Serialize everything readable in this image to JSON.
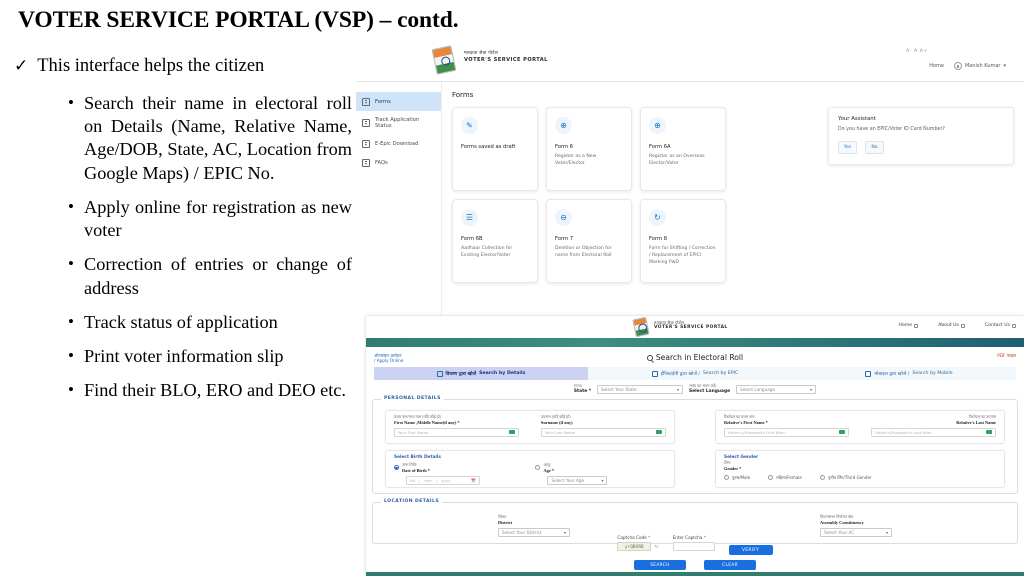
{
  "slide": {
    "title": "VOTER SERVICE PORTAL (VSP) – contd.",
    "lead_tick": "✓",
    "lead_text": "This interface helps the citizen",
    "bullet_glyph": "•",
    "bullets": [
      "Search their name in electoral roll on Details (Name, Relative Name, Age/DOB, State, AC, Location from Google Maps) / EPIC No.",
      "Apply online for registration as new voter",
      "Correction of entries or change of address",
      "Track status of application",
      "Print voter information slip",
      "Find their BLO, ERO and DEO etc."
    ]
  },
  "shot_forms": {
    "brand_hi": "मतदाता सेवा पोर्टल",
    "brand_en": "VOTER'S SERVICE PORTAL",
    "font_size_control": "A- A A+",
    "nav": {
      "home": "Home",
      "user": "Manish Kumar",
      "caret": "▾"
    },
    "sidebar": [
      {
        "label": "Forms",
        "icon": "forms-icon",
        "active": true
      },
      {
        "label": "Track Application Status",
        "icon": "track-icon",
        "active": false
      },
      {
        "label": "E-Epic Download",
        "icon": "download-icon",
        "active": false
      },
      {
        "label": "FAQs",
        "icon": "faq-icon",
        "active": false
      }
    ],
    "page_title": "Forms",
    "cards": [
      {
        "glyph": "✎",
        "title": "Forms saved as draft",
        "desc": ""
      },
      {
        "glyph": "⊕",
        "title": "Form 6",
        "desc": "Register as a New Voter/Elector"
      },
      {
        "glyph": "⊕",
        "title": "Form 6A",
        "desc": "Register as an Overseas Elector/Voter"
      },
      {
        "glyph": "☰",
        "title": "Form 6B",
        "desc": "Aadhaar Collection for Existing Elector/Voter"
      },
      {
        "glyph": "⊖",
        "title": "Form 7",
        "desc": "Deletion or Objection for name from Electoral Roll"
      },
      {
        "glyph": "↻",
        "title": "Form 8",
        "desc": "Form for Shifting / Correction / Replacement of EPIC/ Marking PwD"
      }
    ],
    "assistant": {
      "title": "Your Assistant",
      "question": "Do you have an EPIC/Voter ID Card Number?",
      "yes": "Yes",
      "no": "No"
    }
  },
  "shot_search": {
    "brand_hi": "मतदाता सेवा पोर्टल",
    "brand_en": "VOTER'S SERVICE PORTAL",
    "nav": [
      {
        "label": "Home"
      },
      {
        "label": "About Us"
      },
      {
        "label": "Contact Us"
      }
    ],
    "apply_hi": "ऑनलाइन आवेदन",
    "apply_en": "/ Apply Online",
    "heading": "Search in Electoral Roll",
    "pdf_link": "PDF फाइल",
    "tabs": [
      {
        "hi": "विवरण द्वारा खोजें",
        "en": "Search by Details",
        "icon": "details-icon",
        "active": true
      },
      {
        "hi": "ईपिक/ईपी द्वारा खोजें /",
        "en": "Search by EPIC",
        "icon": "epic-icon",
        "active": false
      },
      {
        "hi": "मोबाइल द्वारा खोजें /",
        "en": "Search by Mobile",
        "icon": "mobile-icon",
        "active": false
      }
    ],
    "state_label_hi": "राज्य/",
    "state_label_en": "State *",
    "state_value": "Select Your State",
    "lang_label_hi": "भाषा का चयन करें/",
    "lang_label_en": "Select Language",
    "lang_value": "Select Language",
    "personal_legend": "PERSONAL DETAILS",
    "fields": {
      "first_name_hi": "प्रथम नाम/मध्य नाम (यदि कोई हो)",
      "first_name_en": "First Name ,Middle Name(if any) *",
      "first_name_placeholder": "Your First Name",
      "surname_hi": "उपनाम (यदि कोई हो)",
      "surname_en": "Surname (if any)",
      "surname_placeholder": "Your Last Name",
      "rel_first_hi": "रिश्तेदार का प्रथम नाम",
      "rel_first_en": "Relative's First Name *",
      "rel_first_placeholder": "Father's/Husband's First Nam",
      "rel_last_hi": "रिश्तेदार का उपनाम",
      "rel_last_en": "Relative's Last Name",
      "rel_last_placeholder": "Father's/Husband's Last Nam",
      "birth_legend": "Select Birth Details",
      "dob_hi": "जन्म तिथि/",
      "dob_en": "Date of Birth *",
      "dob_day": "dd",
      "dob_month": "mm",
      "dob_year": "yyyy",
      "age_hi": "आयु/",
      "age_en": "Age *",
      "age_value": "Select Your Age",
      "gender_legend": "Select Gender",
      "gender_hi": "लिंग/",
      "gender_en": "Gender *",
      "gender_options": [
        "पुरुष/Male",
        "महिला/Female",
        "तृतीय लिंग/Third Gender"
      ]
    },
    "location_legend": "LOCATION DETAILS",
    "district_hi": "जिला/",
    "district_en": "District",
    "district_value": "Select Your District",
    "ac_hi": "विधानसभा निर्वाचन क्षेत्र",
    "ac_en": "Assembly Constituency",
    "ac_value": "Select Your AC",
    "captcha_code_label": "Captcha Code",
    "captcha_code_value": "yrQBXRB",
    "enter_captcha_label": "Enter Captcha",
    "enter_captcha_placeholder": "",
    "verify_button": "VERIFY",
    "search_button": "SEARCH",
    "clear_button": "CLEAR",
    "required_mark": "*"
  }
}
